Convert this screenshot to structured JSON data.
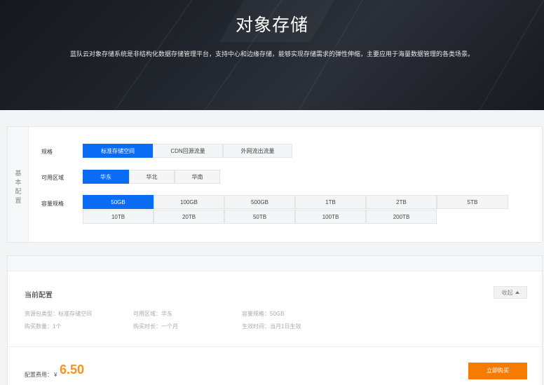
{
  "hero": {
    "title": "对象存储",
    "description": "蓝队云对象存储系统是非结构化数据存储管理平台，支持中心和边缘存储，能够实现存储需求的弹性伸缩，主要应用于海量数据管理的各类场景。"
  },
  "basic_config": {
    "side_label": "基本配置",
    "spec": {
      "label": "规格",
      "options": [
        "标准存储空间",
        "CDN回源流量",
        "外网流出流量"
      ],
      "selected": "标准存储空间"
    },
    "region": {
      "label": "可用区域",
      "options": [
        "华东",
        "华北",
        "华南"
      ],
      "selected": "华东"
    },
    "capacity": {
      "label": "容量规格",
      "options": [
        "50GB",
        "100GB",
        "500GB",
        "1TB",
        "2TB",
        "5TB",
        "10TB",
        "20TB",
        "50TB",
        "100TB",
        "200TB"
      ],
      "selected": "50GB"
    }
  },
  "current": {
    "title": "当前配置",
    "collapse_label": "收起",
    "items": [
      "资源包类型：标准存储空间",
      "可用区域：华东",
      "容量规格：50GB",
      "购买数量：1个",
      "购买时长：一个月",
      "生效时间：当月1日生效"
    ],
    "price_label": "配置费用：",
    "currency": "¥",
    "price": "6.50",
    "buy_label": "立即购买"
  },
  "colors": {
    "accent": "#0a6cf5",
    "price": "#f7931e",
    "buy": "#f57c00"
  }
}
